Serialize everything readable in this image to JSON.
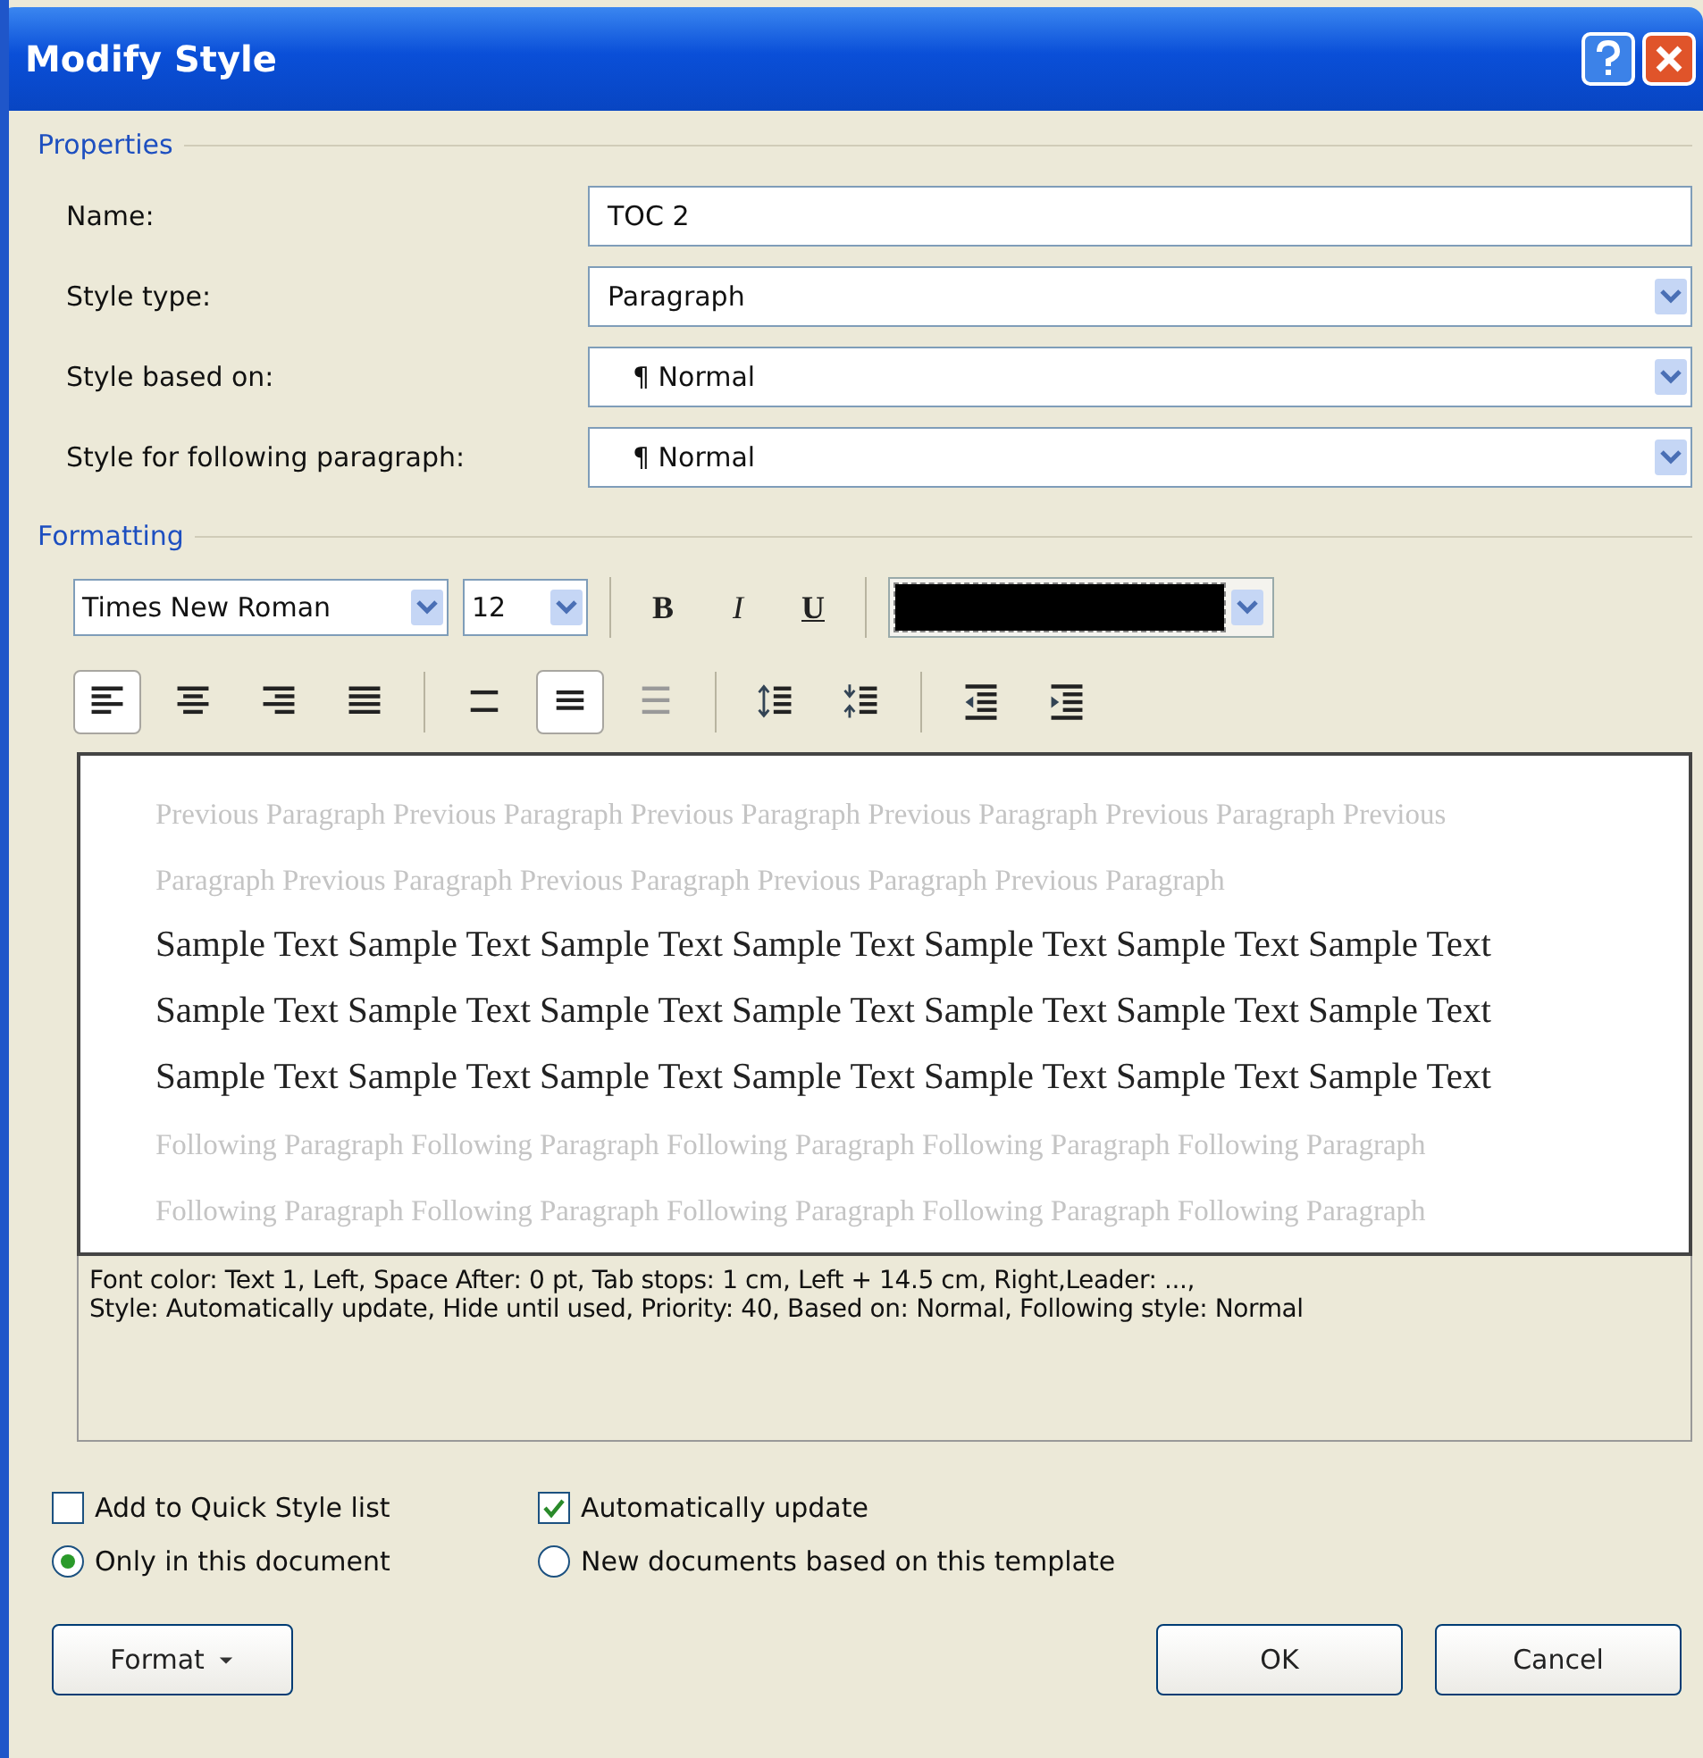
{
  "window": {
    "title": "Modify Style"
  },
  "properties": {
    "legend": "Properties",
    "fields": [
      {
        "label": "Name:",
        "kind": "text",
        "value": "TOC 2"
      },
      {
        "label": "Style type:",
        "kind": "select",
        "value": "Paragraph"
      },
      {
        "label": "Style based on:",
        "kind": "select",
        "value": "¶ Normal"
      },
      {
        "label": "Style for following paragraph:",
        "kind": "select",
        "value": "¶ Normal"
      }
    ]
  },
  "formatting": {
    "legend": "Formatting",
    "font": "Times New Roman",
    "size": "12",
    "text_buttons": [
      {
        "label": "B",
        "kind": "bold"
      },
      {
        "label": "I",
        "kind": "italic"
      },
      {
        "label": "U",
        "kind": "underline"
      }
    ],
    "tool_groups": [
      [
        {
          "kind": "align-left",
          "selected": true
        },
        {
          "kind": "align-center",
          "selected": false
        },
        {
          "kind": "align-right",
          "selected": false
        },
        {
          "kind": "justify",
          "selected": false
        }
      ],
      [
        {
          "kind": "single-spacing",
          "selected": false
        },
        {
          "kind": "one-half-spacing",
          "selected": true
        },
        {
          "kind": "double-spacing",
          "selected": false
        }
      ],
      [
        {
          "kind": "spacing-increase",
          "selected": false
        },
        {
          "kind": "spacing-decrease",
          "selected": false
        }
      ],
      [
        {
          "kind": "indent-decrease",
          "selected": false
        },
        {
          "kind": "indent-increase",
          "selected": false
        }
      ]
    ]
  },
  "preview": {
    "lines": [
      {
        "kind": "previous",
        "text": "Previous Paragraph Previous Paragraph Previous Paragraph Previous Paragraph Previous Paragraph Previous"
      },
      {
        "kind": "previous",
        "text": "Paragraph Previous Paragraph Previous Paragraph Previous Paragraph Previous Paragraph"
      },
      {
        "kind": "sample",
        "text": "Sample Text Sample Text Sample Text Sample Text Sample Text Sample Text Sample Text"
      },
      {
        "kind": "sample",
        "text": "Sample Text Sample Text Sample Text Sample Text Sample Text Sample Text Sample Text"
      },
      {
        "kind": "sample",
        "text": "Sample Text Sample Text Sample Text Sample Text Sample Text Sample Text Sample Text"
      },
      {
        "kind": "following",
        "text": "Following Paragraph Following Paragraph Following Paragraph Following Paragraph Following Paragraph"
      },
      {
        "kind": "following",
        "text": "Following Paragraph Following Paragraph Following Paragraph Following Paragraph Following Paragraph"
      }
    ]
  },
  "description": [
    "Font color: Text 1, Left, Space After:  0 pt, Tab stops:  1 cm, Left +  14.5 cm, Right,Leader: ...,",
    "Style: Automatically update, Hide until used, Priority: 40, Based on:  Normal, Following style: Normal"
  ],
  "checkboxes": [
    {
      "label": "Add to Quick Style list",
      "checked": false
    },
    {
      "label": "Automatically update",
      "checked": true
    }
  ],
  "radios": [
    {
      "label": "Only in this document",
      "selected": true
    },
    {
      "label": "New documents based on this template",
      "selected": false
    }
  ],
  "buttons": {
    "format": "Format",
    "ok": "OK",
    "cancel": "Cancel"
  }
}
